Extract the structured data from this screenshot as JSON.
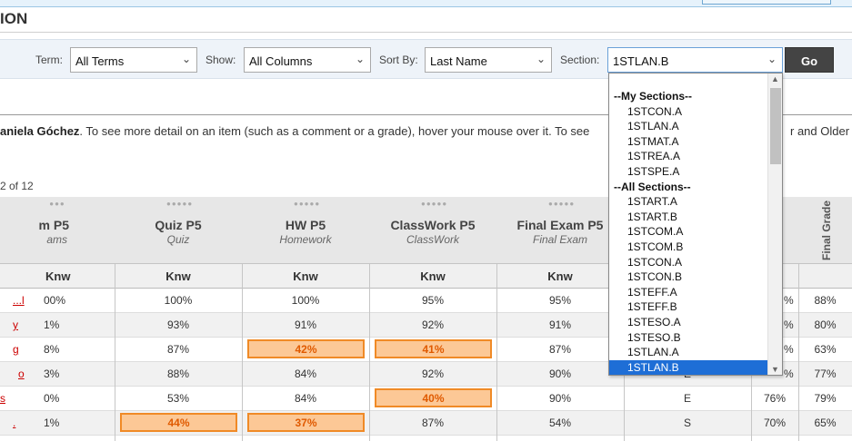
{
  "page_title": "ION",
  "filters": {
    "term_label": "Term:",
    "term_value": "All Terms",
    "show_label": "Show:",
    "show_value": "All Columns",
    "sort_label": "Sort By:",
    "sort_value": "Last Name",
    "section_label": "Section:",
    "section_value": "1STLAN.B",
    "go_label": "Go"
  },
  "info": {
    "student_name": "aniela Góchez",
    "text": ". To see more detail on an item (such as a comment or a grade), hover your mouse over it. To see",
    "tail": "r and Older"
  },
  "count_text": "2 of 12",
  "columns": [
    {
      "name": "m P5",
      "sub": "ams"
    },
    {
      "name": "Quiz P5",
      "sub": "Quiz"
    },
    {
      "name": "HW P5",
      "sub": "Homework"
    },
    {
      "name": "ClassWork P5",
      "sub": "ClassWork"
    },
    {
      "name": "Final Exam P5",
      "sub": "Final Exam"
    }
  ],
  "final_grade_label": "Final Grade",
  "sub_label": "Knw",
  "rows": [
    {
      "name": "...l",
      "c1": "00%",
      "c2": "100%",
      "c3": "100%",
      "c4": "95%",
      "c5": "95%",
      "c6": "",
      "c7": "%",
      "c8": "88%"
    },
    {
      "name": "y",
      "c1": "1%",
      "c2": "93%",
      "c3": "91%",
      "c4": "92%",
      "c5": "91%",
      "c6": "",
      "c7": "%",
      "c8": "80%"
    },
    {
      "name": "g",
      "c1": "8%",
      "c2": "87%",
      "c3": "42%",
      "c4": "41%",
      "c5": "87%",
      "c6": "",
      "c7": "%",
      "c8": "63%"
    },
    {
      "name": "o",
      "c1": "3%",
      "c2": "88%",
      "c3": "84%",
      "c4": "92%",
      "c5": "90%",
      "c6": "E",
      "c7": "%",
      "c8": "77%"
    },
    {
      "name": "s",
      "c1": "0%",
      "c2": "53%",
      "c3": "84%",
      "c4": "40%",
      "c5": "90%",
      "c6": "E",
      "c7": "76%",
      "c8": "79%"
    },
    {
      "name": ".",
      "c1": "1%",
      "c2": "44%",
      "c3": "37%",
      "c4": "87%",
      "c5": "54%",
      "c6": "S",
      "c7": "70%",
      "c8": "65%"
    }
  ],
  "dropdown": {
    "my_sections_label": "--My Sections--",
    "my_sections": [
      "1STCON.A",
      "1STLAN.A",
      "1STMAT.A",
      "1STREA.A",
      "1STSPE.A"
    ],
    "all_sections_label": "--All Sections--",
    "all_sections": [
      "1START.A",
      "1START.B",
      "1STCOM.A",
      "1STCOM.B",
      "1STCON.A",
      "1STCON.B",
      "1STEFF.A",
      "1STEFF.B",
      "1STESO.A",
      "1STESO.B",
      "1STLAN.A",
      "1STLAN.B"
    ],
    "selected": "1STLAN.B"
  },
  "colors": {
    "highlight_bg": "#fcc896",
    "highlight_border": "#f08a26",
    "selection_blue": "#1e6ed6",
    "go_button": "#444444"
  }
}
